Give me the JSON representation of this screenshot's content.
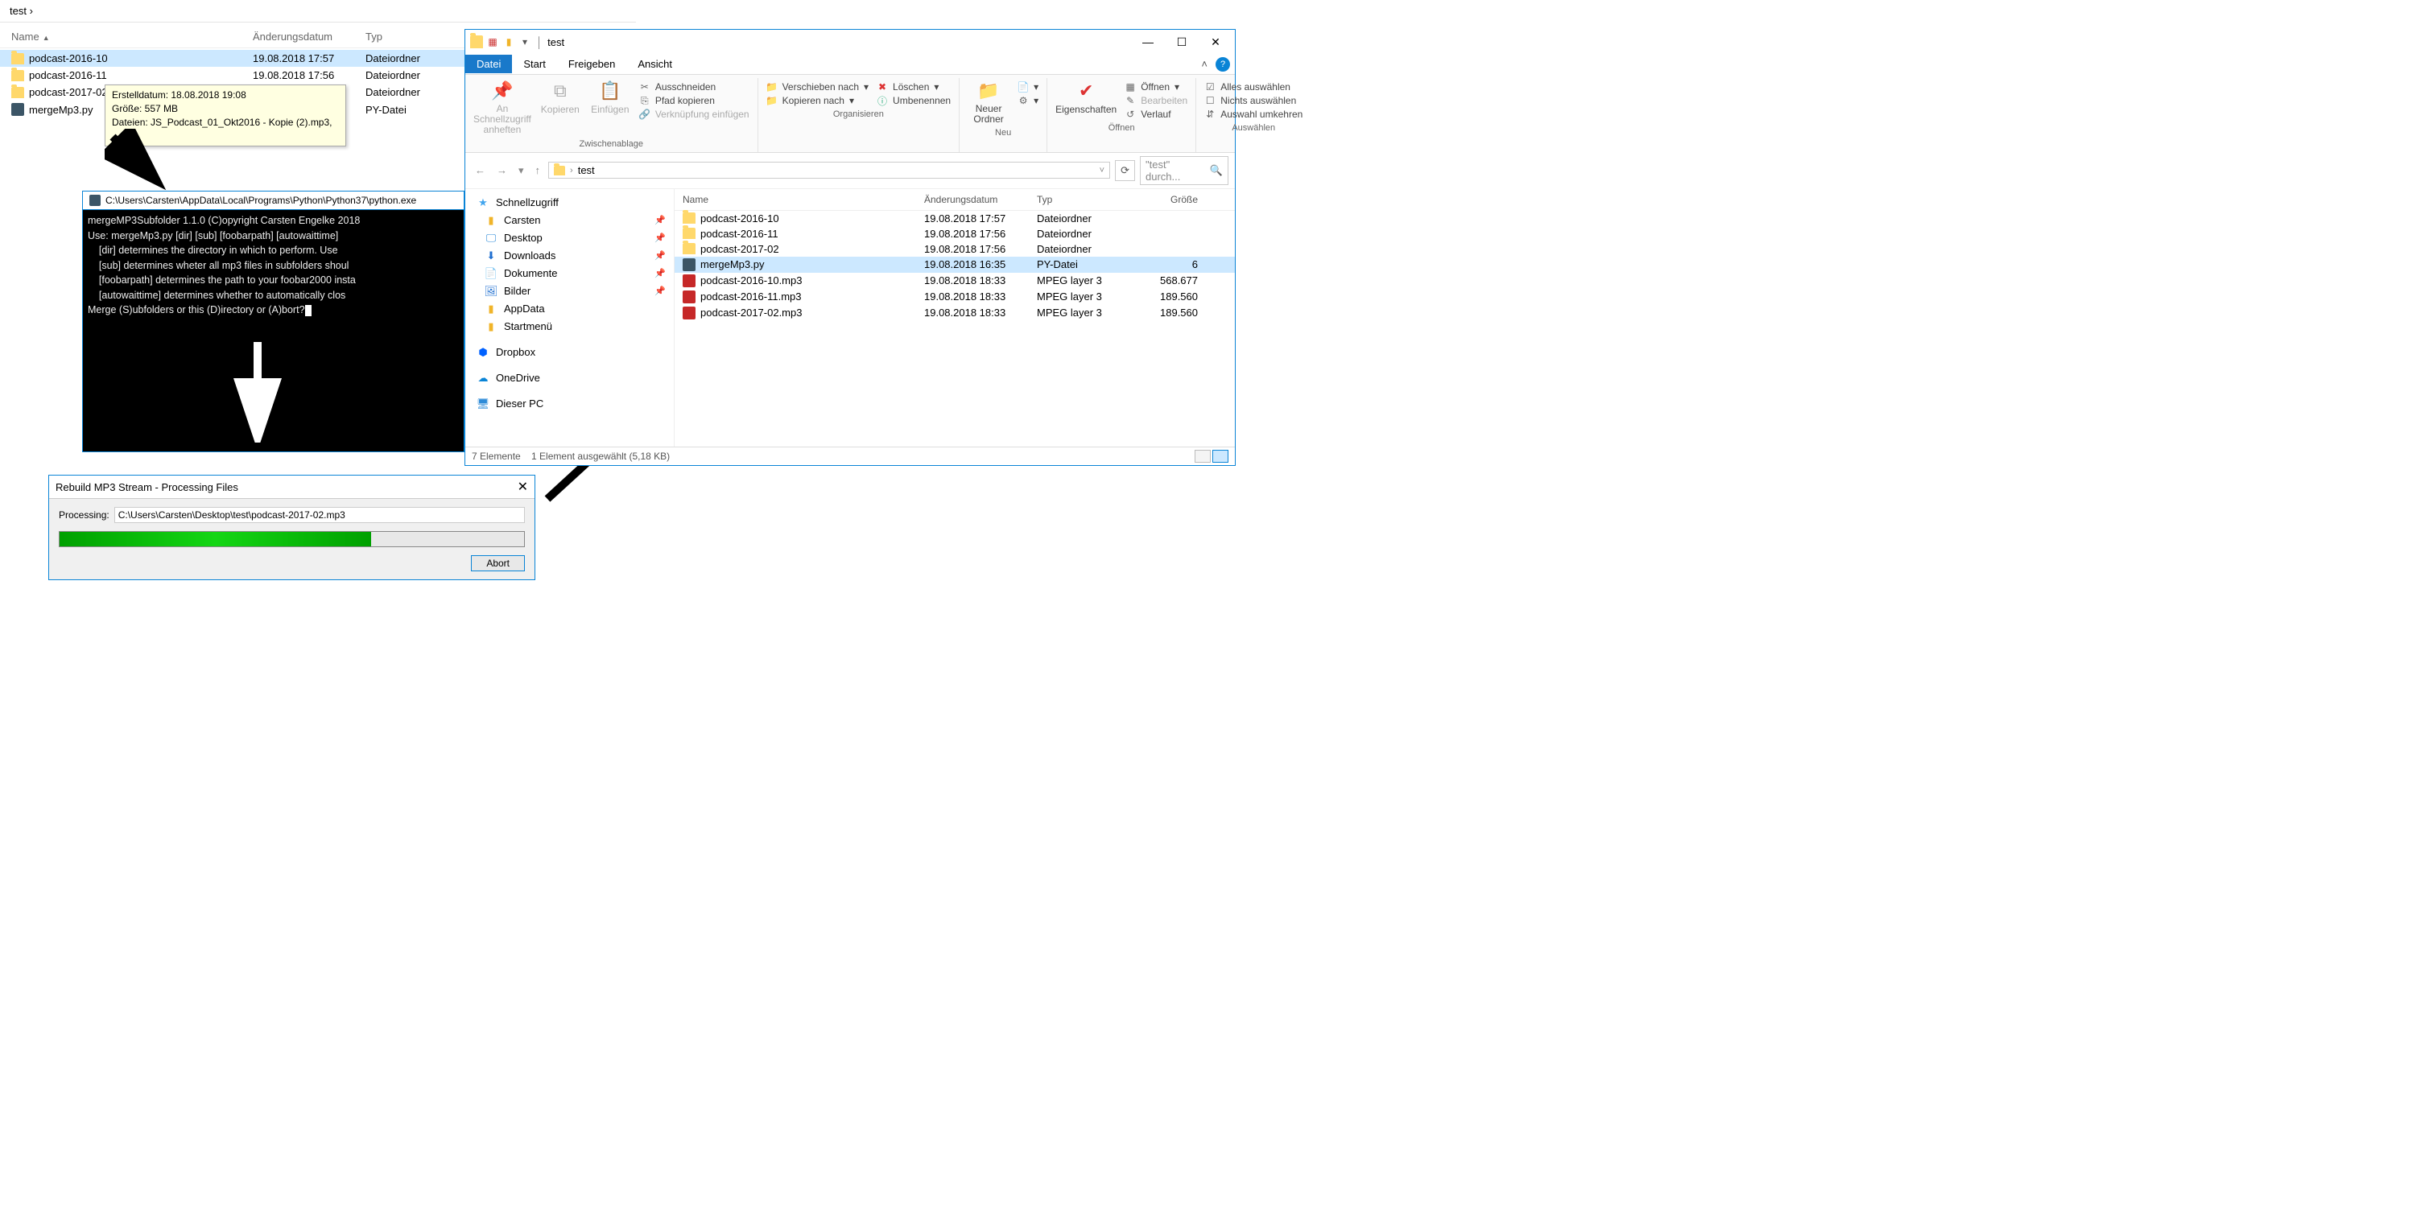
{
  "bg": {
    "breadcrumb": "test  ›",
    "columns": {
      "name": "Name",
      "date": "Änderungsdatum",
      "type": "Typ"
    },
    "rows": [
      {
        "name": "podcast-2016-10",
        "date": "19.08.2018 17:57",
        "type": "Dateiordner",
        "icon": "folder",
        "selected": true
      },
      {
        "name": "podcast-2016-11",
        "date": "19.08.2018 17:56",
        "type": "Dateiordner",
        "icon": "folder"
      },
      {
        "name": "podcast-2017-02",
        "date": "",
        "type": "Dateiordner",
        "icon": "folder"
      },
      {
        "name": "mergeMp3.py",
        "date": "",
        "type": "PY-Datei",
        "icon": "pyfile"
      }
    ],
    "tooltip": {
      "l1": "Erstelldatum: 18.08.2018 19:08",
      "l2": "Größe: 557 MB",
      "l3": "Dateien: JS_Podcast_01_Okt2016 - Kopie (2).mp3, ..."
    }
  },
  "console": {
    "title": "C:\\Users\\Carsten\\AppData\\Local\\Programs\\Python\\Python37\\python.exe",
    "line1": "mergeMP3Subfolder 1.1.0 (C)opyright Carsten Engelke 2018",
    "line2": "Use: mergeMp3.py [dir] [sub] [foobarpath] [autowaittime]",
    "line3": "    [dir] determines the directory in which to perform. Use ",
    "line4": "    [sub] determines wheter all mp3 files in subfolders shoul",
    "line5": "    [foobarpath] determines the path to your foobar2000 insta",
    "line6": "    [autowaittime] determines whether to automatically clos ",
    "line7": "Merge (S)ubfolders or this (D)irectory or (A)bort?"
  },
  "progress": {
    "title": "Rebuild MP3 Stream - Processing Files",
    "processing_label": "Processing:",
    "path": "C:\\Users\\Carsten\\Desktop\\test\\podcast-2017-02.mp3",
    "abort": "Abort"
  },
  "explorer": {
    "titlebar": {
      "folder": "test"
    },
    "menutabs": {
      "file": "Datei",
      "start": "Start",
      "share": "Freigeben",
      "view": "Ansicht"
    },
    "ribbon": {
      "pin": "An Schnellzugriff anheften",
      "copy": "Kopieren",
      "paste": "Einfügen",
      "cut": "Ausschneiden",
      "copypath": "Pfad kopieren",
      "pastelink": "Verknüpfung einfügen",
      "grp_clipboard": "Zwischenablage",
      "moveto": "Verschieben nach",
      "copyto": "Kopieren nach",
      "delete": "Löschen",
      "rename": "Umbenennen",
      "grp_organize": "Organisieren",
      "newfolder": "Neuer Ordner",
      "grp_new": "Neu",
      "properties": "Eigenschaften",
      "open": "Öffnen",
      "edit": "Bearbeiten",
      "history": "Verlauf",
      "grp_open": "Öffnen",
      "selectall": "Alles auswählen",
      "selectnone": "Nichts auswählen",
      "invert": "Auswahl umkehren",
      "grp_select": "Auswählen"
    },
    "nav": {
      "folder": "test",
      "search_placeholder": "\"test\" durch..."
    },
    "tree": {
      "quick": "Schnellzugriff",
      "items": [
        {
          "label": "Carsten",
          "icon": "folder"
        },
        {
          "label": "Desktop",
          "icon": "desktop"
        },
        {
          "label": "Downloads",
          "icon": "downloads"
        },
        {
          "label": "Dokumente",
          "icon": "docs"
        },
        {
          "label": "Bilder",
          "icon": "pictures"
        },
        {
          "label": "AppData",
          "icon": "folder"
        },
        {
          "label": "Startmenü",
          "icon": "folder"
        }
      ],
      "dropbox": "Dropbox",
      "onedrive": "OneDrive",
      "thispc": "Dieser PC"
    },
    "list": {
      "columns": {
        "name": "Name",
        "date": "Änderungsdatum",
        "type": "Typ",
        "size": "Größe"
      },
      "rows": [
        {
          "name": "podcast-2016-10",
          "date": "19.08.2018 17:57",
          "type": "Dateiordner",
          "size": "",
          "icon": "folder"
        },
        {
          "name": "podcast-2016-11",
          "date": "19.08.2018 17:56",
          "type": "Dateiordner",
          "size": "",
          "icon": "folder"
        },
        {
          "name": "podcast-2017-02",
          "date": "19.08.2018 17:56",
          "type": "Dateiordner",
          "size": "",
          "icon": "folder"
        },
        {
          "name": "mergeMp3.py",
          "date": "19.08.2018 16:35",
          "type": "PY-Datei",
          "size": "6",
          "icon": "pyfile",
          "selected": true
        },
        {
          "name": "podcast-2016-10.mp3",
          "date": "19.08.2018 18:33",
          "type": "MPEG layer 3",
          "size": "568.677",
          "icon": "mp3"
        },
        {
          "name": "podcast-2016-11.mp3",
          "date": "19.08.2018 18:33",
          "type": "MPEG layer 3",
          "size": "189.560",
          "icon": "mp3"
        },
        {
          "name": "podcast-2017-02.mp3",
          "date": "19.08.2018 18:33",
          "type": "MPEG layer 3",
          "size": "189.560",
          "icon": "mp3"
        }
      ]
    },
    "status": {
      "count": "7 Elemente",
      "selection": "1 Element ausgewählt (5,18 KB)"
    }
  }
}
